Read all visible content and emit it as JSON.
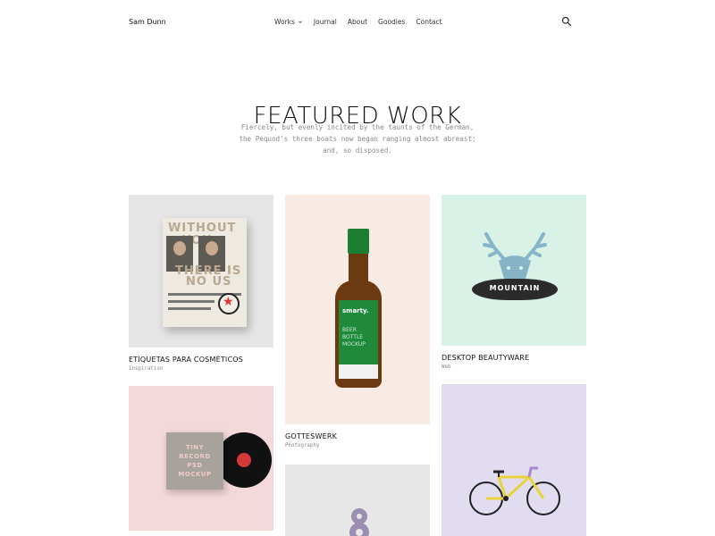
{
  "header": {
    "brand": "Sam Dunn",
    "nav": [
      {
        "label": "Works",
        "has_dropdown": true
      },
      {
        "label": "Journal"
      },
      {
        "label": "About"
      },
      {
        "label": "Goodies"
      },
      {
        "label": "Contact"
      }
    ],
    "search_icon": "search-icon"
  },
  "hero": {
    "title": "FEATURED WORK",
    "subtitle_lines": [
      "Fiercely, but evenly incited by the taunts of the German,",
      "the Pequod's three boats now began ranging almost abreast;",
      "and, so disposed."
    ]
  },
  "works": [
    {
      "title": "ETIQUETAS PARA COSMÉTICOS",
      "category": "Inspiration",
      "bg": "#e6e6e6",
      "art": {
        "book_words": [
          "WITHOUT",
          "YOU",
          "THERE IS",
          "NO US"
        ]
      }
    },
    {
      "title": "GOTTESWERK",
      "category": "Photography",
      "bg": "#f7ebe3",
      "art": {
        "brand": "smarty.",
        "label_lines": [
          "BEER",
          "BOTTLE",
          "MOCKUP"
        ]
      }
    },
    {
      "title": "DESKTOP BEAUTYWARE",
      "category": "Web",
      "bg": "#d8f2e7",
      "art": {
        "banner": "MOUNTAIN"
      }
    },
    {
      "title": "",
      "category": "",
      "bg": "#f3d9d9",
      "art": {
        "sleeve_lines": [
          "TINY",
          "RECORD",
          "PSD",
          "MOCKUP"
        ]
      }
    },
    {
      "title": "",
      "category": "",
      "bg": "#e7e7e7",
      "art": {}
    },
    {
      "title": "",
      "category": "",
      "bg": "#e1dcef",
      "art": {}
    }
  ],
  "colors": {
    "text": "#111111",
    "muted": "#8a8a8a",
    "bottle_green": "#1f8a3a",
    "deer_blue": "#87b5c7",
    "bike_yellow": "#e7d33d"
  }
}
